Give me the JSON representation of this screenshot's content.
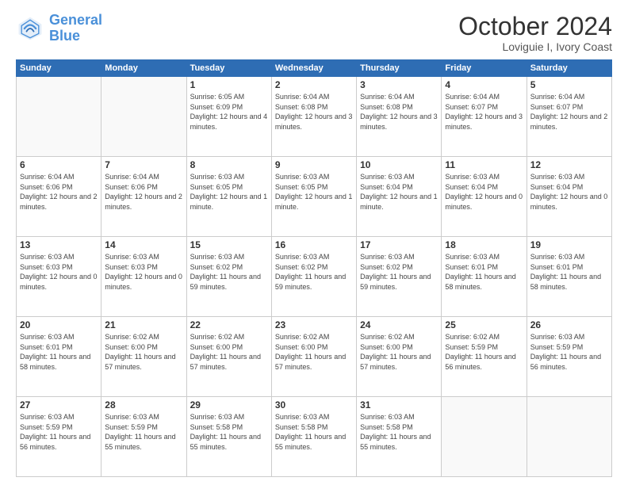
{
  "header": {
    "logo_line1": "General",
    "logo_line2": "Blue",
    "month": "October 2024",
    "location": "Loviguie I, Ivory Coast"
  },
  "weekdays": [
    "Sunday",
    "Monday",
    "Tuesday",
    "Wednesday",
    "Thursday",
    "Friday",
    "Saturday"
  ],
  "weeks": [
    [
      {
        "day": "",
        "sunrise": "",
        "sunset": "",
        "daylight": "",
        "empty": true
      },
      {
        "day": "",
        "sunrise": "",
        "sunset": "",
        "daylight": "",
        "empty": true
      },
      {
        "day": "1",
        "sunrise": "Sunrise: 6:05 AM",
        "sunset": "Sunset: 6:09 PM",
        "daylight": "Daylight: 12 hours and 4 minutes.",
        "empty": false
      },
      {
        "day": "2",
        "sunrise": "Sunrise: 6:04 AM",
        "sunset": "Sunset: 6:08 PM",
        "daylight": "Daylight: 12 hours and 3 minutes.",
        "empty": false
      },
      {
        "day": "3",
        "sunrise": "Sunrise: 6:04 AM",
        "sunset": "Sunset: 6:08 PM",
        "daylight": "Daylight: 12 hours and 3 minutes.",
        "empty": false
      },
      {
        "day": "4",
        "sunrise": "Sunrise: 6:04 AM",
        "sunset": "Sunset: 6:07 PM",
        "daylight": "Daylight: 12 hours and 3 minutes.",
        "empty": false
      },
      {
        "day": "5",
        "sunrise": "Sunrise: 6:04 AM",
        "sunset": "Sunset: 6:07 PM",
        "daylight": "Daylight: 12 hours and 2 minutes.",
        "empty": false
      }
    ],
    [
      {
        "day": "6",
        "sunrise": "Sunrise: 6:04 AM",
        "sunset": "Sunset: 6:06 PM",
        "daylight": "Daylight: 12 hours and 2 minutes.",
        "empty": false
      },
      {
        "day": "7",
        "sunrise": "Sunrise: 6:04 AM",
        "sunset": "Sunset: 6:06 PM",
        "daylight": "Daylight: 12 hours and 2 minutes.",
        "empty": false
      },
      {
        "day": "8",
        "sunrise": "Sunrise: 6:03 AM",
        "sunset": "Sunset: 6:05 PM",
        "daylight": "Daylight: 12 hours and 1 minute.",
        "empty": false
      },
      {
        "day": "9",
        "sunrise": "Sunrise: 6:03 AM",
        "sunset": "Sunset: 6:05 PM",
        "daylight": "Daylight: 12 hours and 1 minute.",
        "empty": false
      },
      {
        "day": "10",
        "sunrise": "Sunrise: 6:03 AM",
        "sunset": "Sunset: 6:04 PM",
        "daylight": "Daylight: 12 hours and 1 minute.",
        "empty": false
      },
      {
        "day": "11",
        "sunrise": "Sunrise: 6:03 AM",
        "sunset": "Sunset: 6:04 PM",
        "daylight": "Daylight: 12 hours and 0 minutes.",
        "empty": false
      },
      {
        "day": "12",
        "sunrise": "Sunrise: 6:03 AM",
        "sunset": "Sunset: 6:04 PM",
        "daylight": "Daylight: 12 hours and 0 minutes.",
        "empty": false
      }
    ],
    [
      {
        "day": "13",
        "sunrise": "Sunrise: 6:03 AM",
        "sunset": "Sunset: 6:03 PM",
        "daylight": "Daylight: 12 hours and 0 minutes.",
        "empty": false
      },
      {
        "day": "14",
        "sunrise": "Sunrise: 6:03 AM",
        "sunset": "Sunset: 6:03 PM",
        "daylight": "Daylight: 12 hours and 0 minutes.",
        "empty": false
      },
      {
        "day": "15",
        "sunrise": "Sunrise: 6:03 AM",
        "sunset": "Sunset: 6:02 PM",
        "daylight": "Daylight: 11 hours and 59 minutes.",
        "empty": false
      },
      {
        "day": "16",
        "sunrise": "Sunrise: 6:03 AM",
        "sunset": "Sunset: 6:02 PM",
        "daylight": "Daylight: 11 hours and 59 minutes.",
        "empty": false
      },
      {
        "day": "17",
        "sunrise": "Sunrise: 6:03 AM",
        "sunset": "Sunset: 6:02 PM",
        "daylight": "Daylight: 11 hours and 59 minutes.",
        "empty": false
      },
      {
        "day": "18",
        "sunrise": "Sunrise: 6:03 AM",
        "sunset": "Sunset: 6:01 PM",
        "daylight": "Daylight: 11 hours and 58 minutes.",
        "empty": false
      },
      {
        "day": "19",
        "sunrise": "Sunrise: 6:03 AM",
        "sunset": "Sunset: 6:01 PM",
        "daylight": "Daylight: 11 hours and 58 minutes.",
        "empty": false
      }
    ],
    [
      {
        "day": "20",
        "sunrise": "Sunrise: 6:03 AM",
        "sunset": "Sunset: 6:01 PM",
        "daylight": "Daylight: 11 hours and 58 minutes.",
        "empty": false
      },
      {
        "day": "21",
        "sunrise": "Sunrise: 6:02 AM",
        "sunset": "Sunset: 6:00 PM",
        "daylight": "Daylight: 11 hours and 57 minutes.",
        "empty": false
      },
      {
        "day": "22",
        "sunrise": "Sunrise: 6:02 AM",
        "sunset": "Sunset: 6:00 PM",
        "daylight": "Daylight: 11 hours and 57 minutes.",
        "empty": false
      },
      {
        "day": "23",
        "sunrise": "Sunrise: 6:02 AM",
        "sunset": "Sunset: 6:00 PM",
        "daylight": "Daylight: 11 hours and 57 minutes.",
        "empty": false
      },
      {
        "day": "24",
        "sunrise": "Sunrise: 6:02 AM",
        "sunset": "Sunset: 6:00 PM",
        "daylight": "Daylight: 11 hours and 57 minutes.",
        "empty": false
      },
      {
        "day": "25",
        "sunrise": "Sunrise: 6:02 AM",
        "sunset": "Sunset: 5:59 PM",
        "daylight": "Daylight: 11 hours and 56 minutes.",
        "empty": false
      },
      {
        "day": "26",
        "sunrise": "Sunrise: 6:03 AM",
        "sunset": "Sunset: 5:59 PM",
        "daylight": "Daylight: 11 hours and 56 minutes.",
        "empty": false
      }
    ],
    [
      {
        "day": "27",
        "sunrise": "Sunrise: 6:03 AM",
        "sunset": "Sunset: 5:59 PM",
        "daylight": "Daylight: 11 hours and 56 minutes.",
        "empty": false
      },
      {
        "day": "28",
        "sunrise": "Sunrise: 6:03 AM",
        "sunset": "Sunset: 5:59 PM",
        "daylight": "Daylight: 11 hours and 55 minutes.",
        "empty": false
      },
      {
        "day": "29",
        "sunrise": "Sunrise: 6:03 AM",
        "sunset": "Sunset: 5:58 PM",
        "daylight": "Daylight: 11 hours and 55 minutes.",
        "empty": false
      },
      {
        "day": "30",
        "sunrise": "Sunrise: 6:03 AM",
        "sunset": "Sunset: 5:58 PM",
        "daylight": "Daylight: 11 hours and 55 minutes.",
        "empty": false
      },
      {
        "day": "31",
        "sunrise": "Sunrise: 6:03 AM",
        "sunset": "Sunset: 5:58 PM",
        "daylight": "Daylight: 11 hours and 55 minutes.",
        "empty": false
      },
      {
        "day": "",
        "sunrise": "",
        "sunset": "",
        "daylight": "",
        "empty": true
      },
      {
        "day": "",
        "sunrise": "",
        "sunset": "",
        "daylight": "",
        "empty": true
      }
    ]
  ]
}
